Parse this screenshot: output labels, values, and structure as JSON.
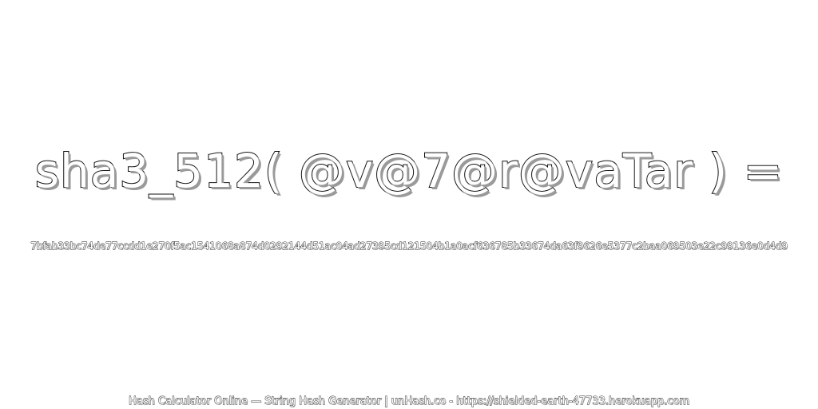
{
  "heading": {
    "text": "sha3_512( @v@7@r@vaTar ) ="
  },
  "result": {
    "hash": "7bfab33bc74de77ccdd1e270f5ac1541068a874d0292144d51ac04ad27395cd121504b1a0acf636785b33674da63f9626e5377c2baa069503e22c99136e0d4d9"
  },
  "footer": {
    "text": "Hash Calculator Online — String Hash Generator | unHash.co - https://shielded-earth-47733.herokuapp.com"
  }
}
